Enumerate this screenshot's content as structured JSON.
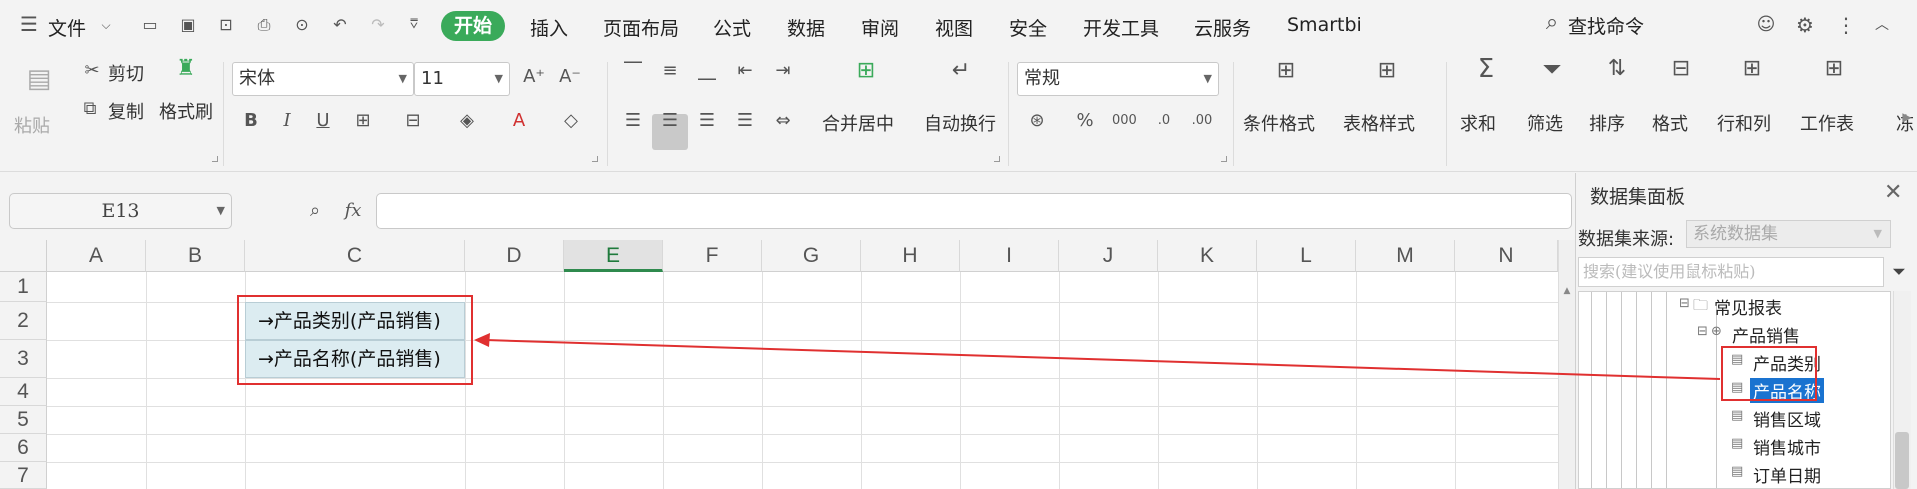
{
  "menubar": {
    "file_label": "文件",
    "tabs": [
      "开始",
      "插入",
      "页面布局",
      "公式",
      "数据",
      "审阅",
      "视图",
      "安全",
      "开发工具",
      "云服务",
      "Smartbi"
    ],
    "search_label": "查找命令"
  },
  "ribbon": {
    "paste": "粘贴",
    "cut": "剪切",
    "copy": "复制",
    "format_painter": "格式刷",
    "font_name": "宋体",
    "font_size": "11",
    "merge_center": "合并居中",
    "wrap_text": "自动换行",
    "number_format": "常规",
    "conditional_format": "条件格式",
    "table_style": "表格样式",
    "sum": "求和",
    "filter": "筛选",
    "sort": "排序",
    "format": "格式",
    "rows_cols": "行和列",
    "worksheet": "工作表",
    "more": "冻"
  },
  "formula_bar": {
    "name_box": "E13",
    "fx_label": "fx",
    "formula": ""
  },
  "sheet": {
    "columns": [
      "A",
      "B",
      "C",
      "D",
      "E",
      "F",
      "G",
      "H",
      "I",
      "J",
      "K",
      "L",
      "M",
      "N"
    ],
    "selected_column": "E",
    "rows": [
      "1",
      "2",
      "3",
      "4",
      "5",
      "6",
      "7"
    ],
    "cells": {
      "C2": "→产品类别(产品销售)",
      "C3": "→产品名称(产品销售)"
    }
  },
  "panel": {
    "title": "数据集面板",
    "source_label": "数据集来源:",
    "source_value": "系统数据集",
    "search_placeholder": "搜索(建议使用鼠标粘贴)",
    "tree": {
      "folder": "常见报表",
      "dataset": "产品销售",
      "fields": [
        "产品类别",
        "产品名称",
        "销售区域",
        "销售城市",
        "订单日期"
      ],
      "selected_field": "产品名称"
    }
  },
  "colors": {
    "accent_green": "#3aaa5a",
    "highlight_blue": "#1a73d0",
    "annotation_red": "#e03030",
    "field_cell_bg": "#dcecf1"
  }
}
